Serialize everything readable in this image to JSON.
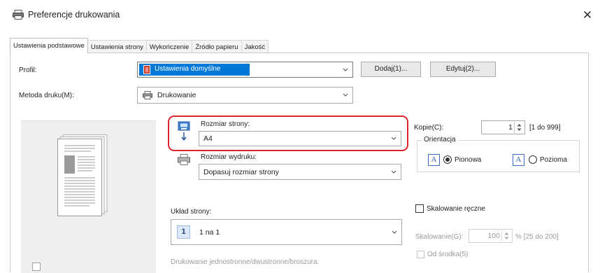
{
  "window": {
    "title": "Preferencje drukowania",
    "close_symbol": "✕"
  },
  "tabs": [
    {
      "label": "Ustawienia podstawowe",
      "active": true
    },
    {
      "label": "Ustawienia strony"
    },
    {
      "label": "Wykończenie"
    },
    {
      "label": "Źródło papieru"
    },
    {
      "label": "Jakość"
    }
  ],
  "profile": {
    "label": "Profil:",
    "value": "Ustawienia domyślne",
    "add_button": "Dodaj(1)...",
    "edit_button": "Edytuj(2)..."
  },
  "print_method": {
    "label": "Metoda druku(M):",
    "value": "Drukowanie"
  },
  "page_size": {
    "label": "Rozmiar strony:",
    "value": "A4"
  },
  "output_size": {
    "label": "Rozmiar wydruku:",
    "value": "Dopasuj rozmiar strony"
  },
  "copies": {
    "label": "Kopie(C):",
    "value": "1",
    "range": "[1 do 999]"
  },
  "orientation": {
    "group_label": "Orientacja",
    "portrait_label": "Pionowa",
    "landscape_label": "Pozioma",
    "icon_glyph": "A",
    "selected": "Pionowa"
  },
  "page_layout": {
    "label": "Układ strony:",
    "icon_text": "1",
    "value": "1 na 1"
  },
  "manual_scaling": {
    "checkbox_label": "Skalowanie ręczne",
    "checked": false,
    "scaling_label": "Skalowanie(G):",
    "scaling_value": "100",
    "scaling_range": "% [25 do 200]",
    "center_label": "Od środka(5)"
  },
  "duplex": {
    "label": "Drukowanie jednostronne/dwustronne/broszura:"
  },
  "colors": {
    "accent": "#0078d7",
    "highlight": "#d9232d",
    "profile_icon": "#c42b1c"
  }
}
